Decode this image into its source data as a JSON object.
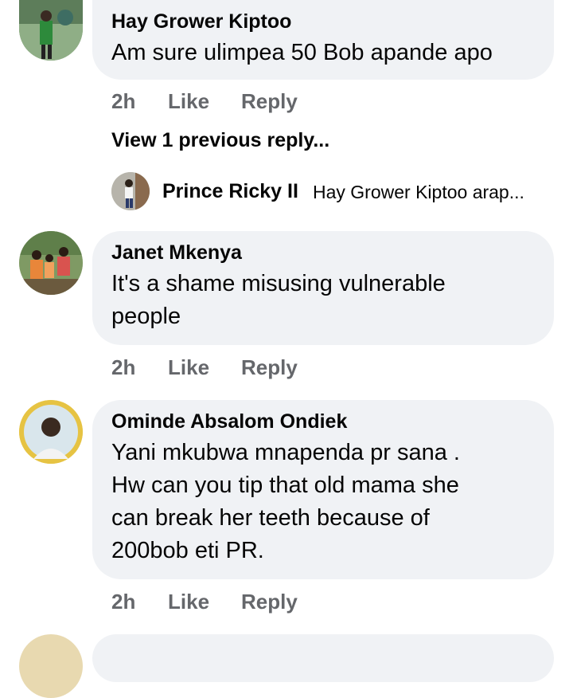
{
  "comments": [
    {
      "author": "Hay Grower Kiptoo",
      "text": "Am sure ulimpea 50 Bob apande apo",
      "time": "2h",
      "like_label": "Like",
      "reply_label": "Reply"
    },
    {
      "author": "Janet Mkenya",
      "text_lines": [
        "It's a shame misusing vulnerable",
        "people"
      ],
      "time": "2h",
      "like_label": "Like",
      "reply_label": "Reply"
    },
    {
      "author": "Ominde Absalom Ondiek",
      "text_lines": [
        "Yani mkubwa mnapenda pr sana .",
        "Hw can you tip that old mama she",
        "can break her teeth because of",
        "200bob eti PR."
      ],
      "time": "2h",
      "like_label": "Like",
      "reply_label": "Reply"
    }
  ],
  "replies": {
    "view_previous_label": "View 1 previous reply...",
    "preview": {
      "author": "Prince Ricky II",
      "text": "Hay Grower Kiptoo arap..."
    }
  },
  "colors": {
    "bubble": "#f0f2f5",
    "meta_text": "#65676b",
    "primary_text": "#050505"
  }
}
